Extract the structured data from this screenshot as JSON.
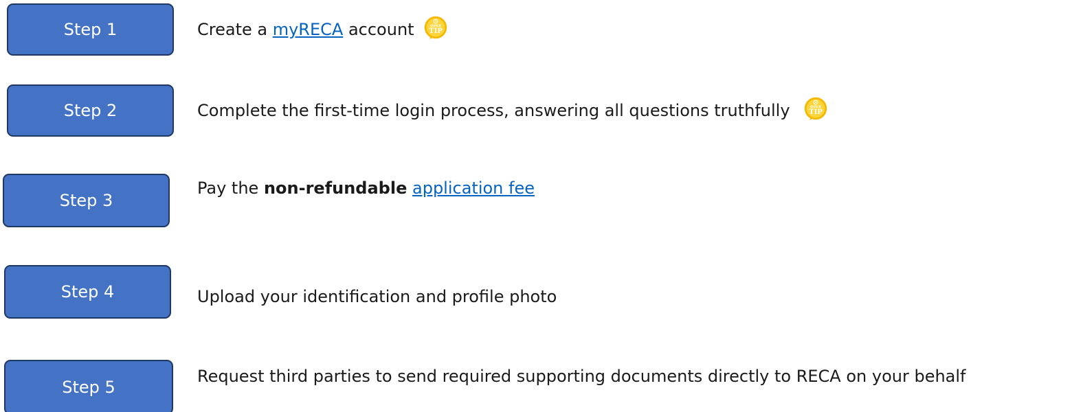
{
  "steps": [
    {
      "label": "Step 1",
      "prefix": "Create a ",
      "link": "myRECA",
      "suffix": " account",
      "has_tip": true
    },
    {
      "label": "Step 2",
      "text": "Complete the first-time login process, answering all questions truthfully",
      "has_tip": true
    },
    {
      "label": "Step 3",
      "prefix": "Pay the ",
      "bold": "non-refundable",
      "space": " ",
      "link": "application fee"
    },
    {
      "label": "Step 4",
      "text": "Upload your identification and profile photo"
    },
    {
      "label": "Step 5",
      "text": "Request third parties to send required supporting documents directly to RECA on your behalf"
    }
  ],
  "tip_icon": {
    "name": "quick-tip-icon",
    "top_text": "QUICK",
    "main_text": "TIP",
    "color": "#f5b800"
  },
  "colors": {
    "button_fill": "#4472c4",
    "button_border": "#1f3763",
    "link": "#0563c1"
  }
}
